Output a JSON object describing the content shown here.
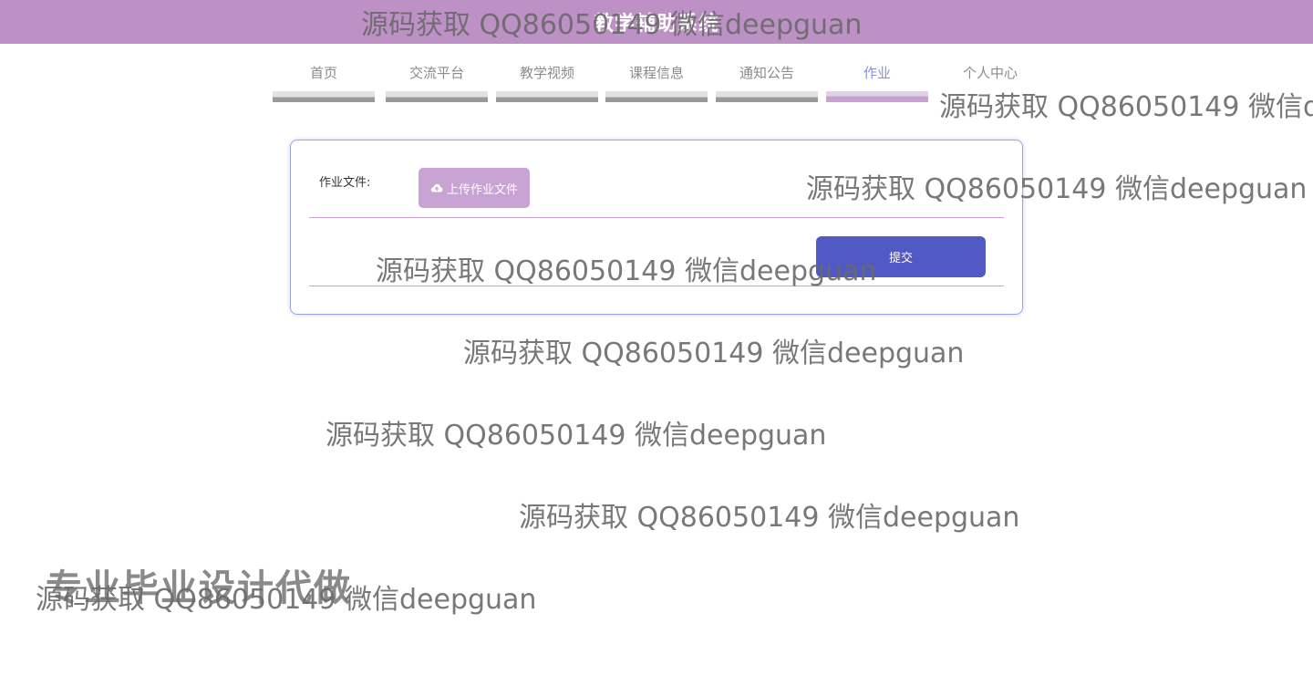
{
  "header": {
    "title": "教学辅助系统"
  },
  "nav": {
    "items": [
      {
        "label": "首页",
        "active": false
      },
      {
        "label": "交流平台",
        "active": false
      },
      {
        "label": "教学视频",
        "active": false
      },
      {
        "label": "课程信息",
        "active": false
      },
      {
        "label": "通知公告",
        "active": false
      },
      {
        "label": "作业",
        "active": true
      },
      {
        "label": "个人中心",
        "active": false
      }
    ]
  },
  "form": {
    "file_label": "作业文件:",
    "upload_label": "上传作业文件",
    "submit_label": "提交"
  },
  "banner": {
    "text": "专业毕业设计代做"
  },
  "watermark": {
    "text": "源码获取 QQ86050149 微信deepguan"
  },
  "colors": {
    "header_bg": "#bd90c6",
    "upload_button": "#c8a4d4",
    "submit_button": "#5059c4",
    "active_nav": "#8a8fe0"
  }
}
